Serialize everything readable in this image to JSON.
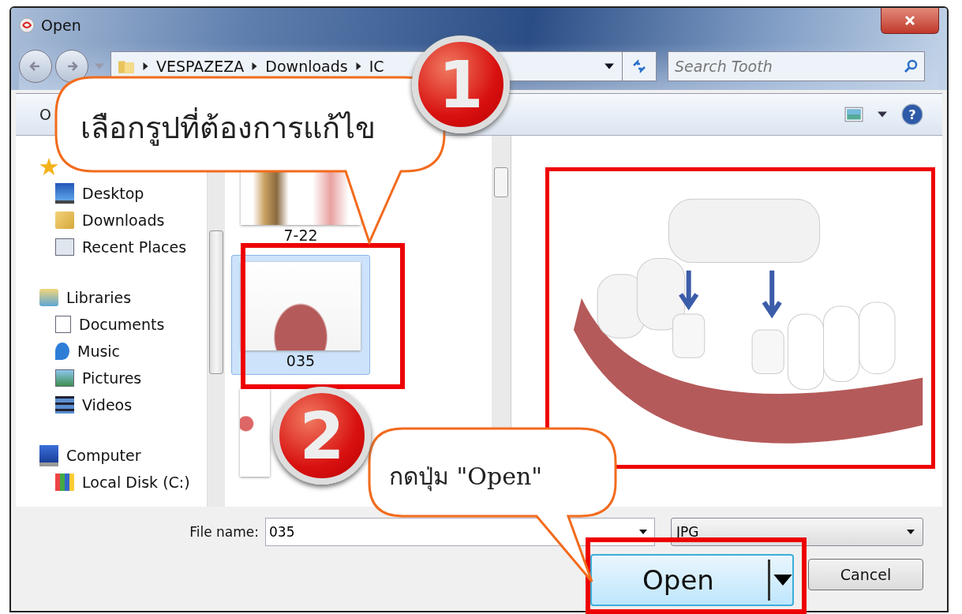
{
  "window": {
    "title": "Open"
  },
  "address_bar": {
    "path": [
      "VESPAZEZA",
      "Downloads",
      "IC"
    ]
  },
  "search": {
    "placeholder": "Search Tooth"
  },
  "toolbar": {
    "items": [
      "O"
    ],
    "help": "?"
  },
  "sidebar": {
    "sections": [
      {
        "kind": "star",
        "children": [
          {
            "label": "Desktop",
            "kind": "desktop"
          },
          {
            "label": "Downloads",
            "kind": "downloads"
          },
          {
            "label": "Recent Places",
            "kind": "recent"
          }
        ]
      },
      {
        "label": "Libraries",
        "kind": "library",
        "children": [
          {
            "label": "Documents",
            "kind": "document"
          },
          {
            "label": "Music",
            "kind": "music"
          },
          {
            "label": "Pictures",
            "kind": "pictures"
          },
          {
            "label": "Videos",
            "kind": "videos"
          }
        ]
      },
      {
        "label": "Computer",
        "kind": "computer",
        "children": [
          {
            "label": "Local Disk (C:)",
            "kind": "disk"
          }
        ]
      }
    ]
  },
  "files": [
    {
      "name": "7-22",
      "selected": false
    },
    {
      "name": "035",
      "selected": true
    },
    {
      "selected": false
    }
  ],
  "file_name": {
    "label": "File name:",
    "value": "035"
  },
  "file_type": {
    "value": "JPG"
  },
  "buttons": [
    {
      "label": "Open",
      "kind": "split",
      "default": true
    },
    {
      "label": "Cancel",
      "kind": "plain",
      "default": false
    }
  ],
  "annotations": [
    {
      "number": "1",
      "text": "เลือกรูปที่ต้องการแก้ไข"
    },
    {
      "number": "2",
      "text": "กดปุ่ม \"Open\""
    }
  ]
}
